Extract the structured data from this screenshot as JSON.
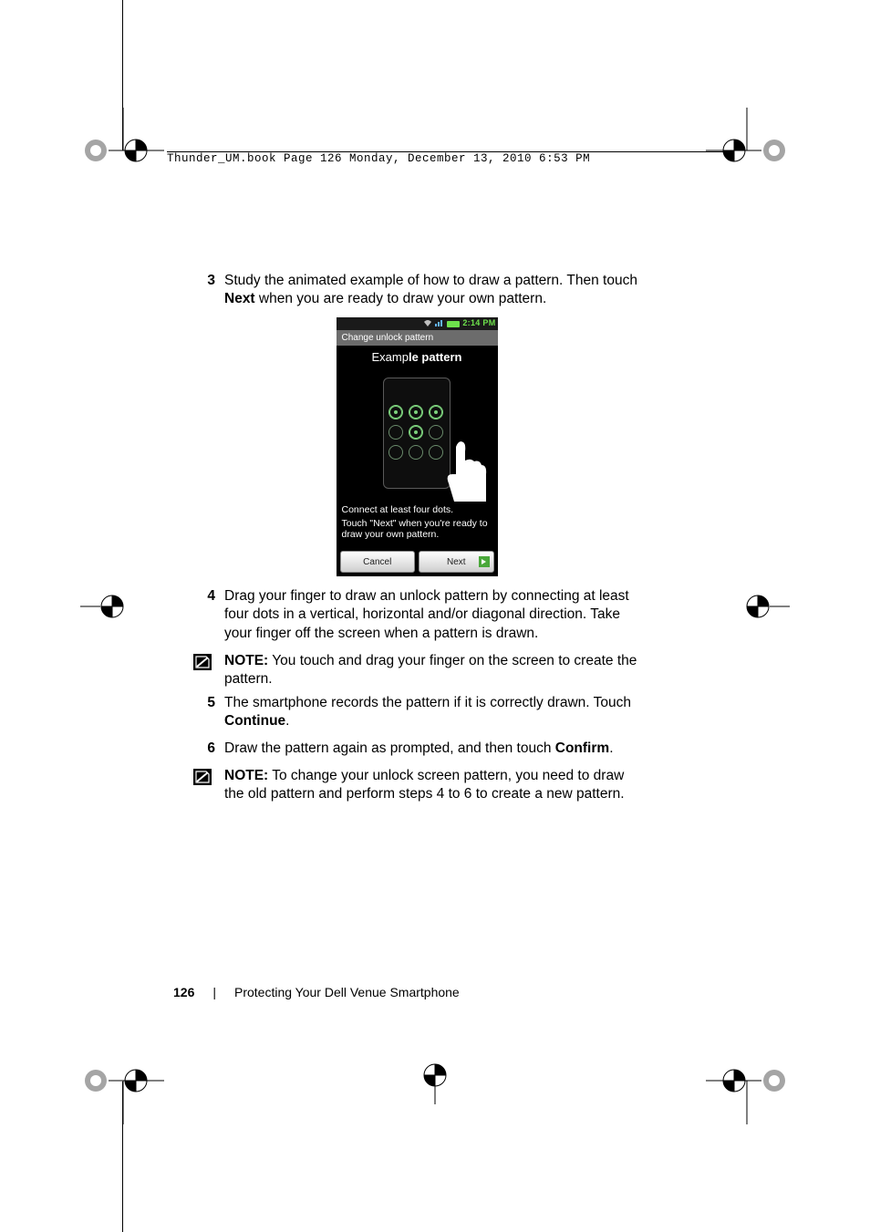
{
  "header_text": "Thunder_UM.book  Page 126  Monday, December 13, 2010  6:53 PM",
  "steps": {
    "s3_num": "3",
    "s3_text_a": "Study the animated example of how to draw a pattern. Then touch ",
    "s3_bold": "Next",
    "s3_text_b": " when you are ready to draw your own pattern.",
    "s4_num": "4",
    "s4_text": "Drag your finger to draw an unlock pattern by connecting at least four dots in a vertical, horizontal and/or diagonal direction. Take your finger off the screen when a pattern is drawn.",
    "s5_num": "5",
    "s5_text_a": "The smartphone records the pattern if it is correctly drawn. Touch ",
    "s5_bold": "Continue",
    "s5_text_b": ".",
    "s6_num": "6",
    "s6_text_a": "Draw the pattern again as prompted, and then touch ",
    "s6_bold": "Confirm",
    "s6_text_b": "."
  },
  "notes": {
    "label": "NOTE:",
    "n1": " You touch and drag your finger on the screen to create the pattern.",
    "n2": " To change your unlock screen pattern, you need to draw the old pattern and perform steps 4 to 6 to create a new pattern."
  },
  "phone": {
    "time": "2:14 PM",
    "title_bar": "Change unlock pattern",
    "example_a": "Examp",
    "example_b": "le pattern",
    "instr1": "Connect at least four dots.",
    "instr2": "Touch \"Next\" when you're ready to draw your own pattern.",
    "cancel": "Cancel",
    "next": "Next"
  },
  "footer": {
    "page": "126",
    "section": "Protecting Your Dell Venue Smartphone"
  }
}
